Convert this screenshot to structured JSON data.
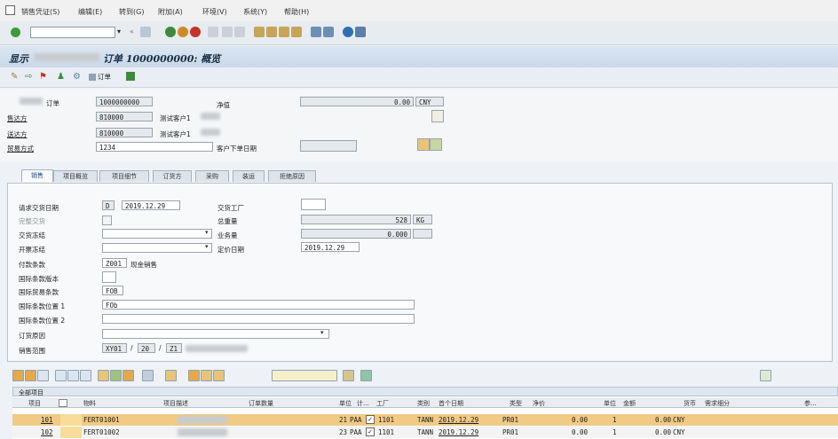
{
  "menu": [
    "销售凭证(S)",
    "编辑(E)",
    "转到(G)",
    "附加(A)",
    "环境(V)",
    "系统(Y)",
    "帮助(H)"
  ],
  "window_title": "显示",
  "window_title_suffix": "订单 1000000000: 概览",
  "app_toolbar": {
    "order_button": "订单"
  },
  "header": {
    "order_label": "订单",
    "order_value": "1000000000",
    "net_value_label": "净值",
    "net_value": "0.00",
    "currency": "CNY",
    "sold_to_label": "售达方",
    "sold_to_value": "810000",
    "sold_to_name": "测试客户1",
    "ship_to_label": "送达方",
    "ship_to_value": "810000",
    "ship_to_name": "测试客户1",
    "trade_mode_label": "贸易方式",
    "trade_mode_value": "1234",
    "customer_order_date_label": "客户下单日期"
  },
  "tabs": [
    "销售",
    "项目概览",
    "项目细节",
    "订货方",
    "采购",
    "装运",
    "拒绝原因"
  ],
  "sales_tab": {
    "req_delivery_date_label": "请求交货日期",
    "req_delivery_date_prefix": "D",
    "req_delivery_date": "2019.12.29",
    "delivery_plant_label": "交货工厂",
    "complete_delivery_label": "完整交货",
    "total_weight_label": "总重量",
    "total_weight": "528",
    "weight_unit": "KG",
    "delivery_block_label": "交货冻结",
    "volume_label": "业务量",
    "volume": "0.000",
    "billing_block_label": "开票冻结",
    "pricing_date_label": "定价日期",
    "pricing_date": "2019.12.29",
    "payment_terms_label": "付款条款",
    "payment_terms_code": "Z001",
    "payment_terms_desc": "现金销售",
    "incoterms_version_label": "国际条款版本",
    "incoterms_label": "国际贸易条款",
    "incoterms_value": "FOB",
    "incoterms_loc1_label": "国际条款位置 1",
    "incoterms_loc1_value": "FOb",
    "incoterms_loc2_label": "国际条款位置 2",
    "order_reason_label": "订货原因",
    "sales_area_label": "销售范围",
    "sales_area": [
      "XY01",
      "20",
      "Z1"
    ],
    "sales_area_sep": "/"
  },
  "items": {
    "caption": "全部项目",
    "columns": [
      "项目",
      "物料",
      "项目描述",
      "订单数量",
      "单位",
      "计...",
      "工厂",
      "类别",
      "首个日期",
      "类型",
      "净价",
      "单位",
      "金额",
      "货币",
      "需求细分",
      "参..."
    ],
    "rows": [
      {
        "item": "101",
        "material": "FERT01001",
        "qty": "21",
        "unit": "PAA",
        "checked": "✓",
        "plant": "1101",
        "category": "TANN",
        "date": "2019.12.29",
        "type": "PR01",
        "net_price": "0.00",
        "per": "1",
        "amount": "0.00",
        "currency": "CNY"
      },
      {
        "item": "102",
        "material": "FERT01002",
        "qty": "23",
        "unit": "PAA",
        "checked": "✓",
        "plant": "1101",
        "category": "TANN",
        "date": "2019.12.29",
        "type": "PR01",
        "net_price": "0.00",
        "per": "1",
        "amount": "0.00",
        "currency": "CNY"
      }
    ]
  },
  "colors": {
    "title_bar": "#c9d8e8",
    "selected_row": "#f1ca84",
    "background": "#eef2f6"
  }
}
